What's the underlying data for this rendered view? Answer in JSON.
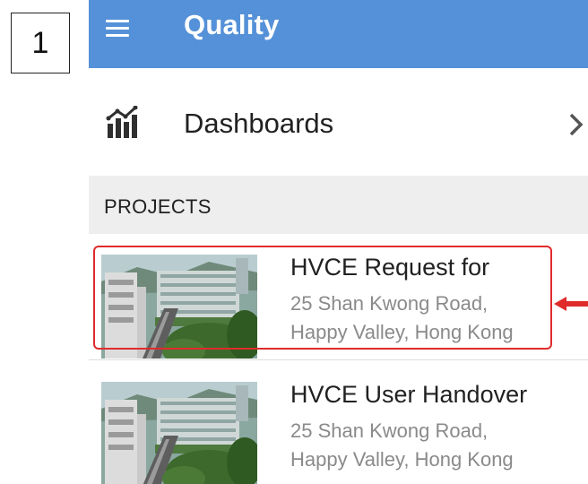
{
  "step_number": "1",
  "appbar": {
    "title": "Quality",
    "menu_icon": "hamburger-menu-icon"
  },
  "dashboards": {
    "label": "Dashboards",
    "icon": "bar-chart-icon",
    "chevron": "chevron-right-icon"
  },
  "projects_section": {
    "header": "PROJECTS"
  },
  "projects": [
    {
      "name": "HVCE Request for",
      "address_line1": "25 Shan Kwong Road,",
      "address_line2": "Happy Valley, Hong Kong",
      "highlighted": true
    },
    {
      "name": "HVCE User Handover",
      "address_line1": "25 Shan Kwong Road,",
      "address_line2": "Happy Valley, Hong Kong",
      "highlighted": false
    }
  ],
  "colors": {
    "appbar": "#5591d8",
    "highlight": "#e02b2b",
    "section_bg": "#eeeeee",
    "secondary_text": "#8a8a8a"
  }
}
